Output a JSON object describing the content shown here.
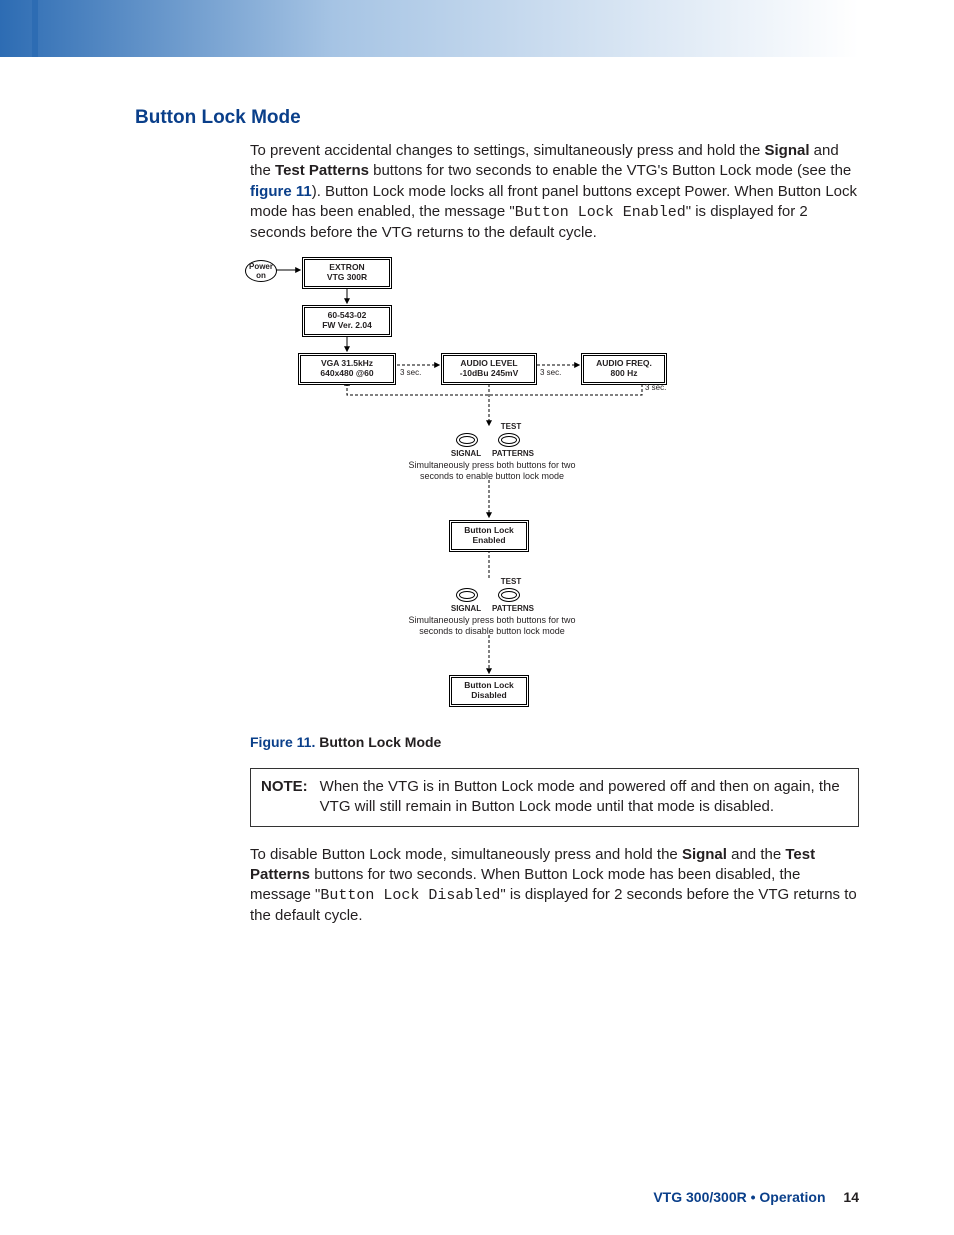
{
  "heading": "Button Lock Mode",
  "intro": {
    "pre": "To prevent accidental changes to settings, simultaneously press and hold the ",
    "b1": "Signal",
    "mid1": " and the ",
    "b2": "Test Patterns",
    "mid2": " buttons for two seconds to enable the VTG's Button Lock mode (see the ",
    "link": "figure 11",
    "mid3": "). Button Lock mode locks all front panel buttons except Power. When Button Lock mode has been enabled, the message \"",
    "mono": "Button Lock Enabled",
    "post": "\" is displayed for 2 seconds before the VTG returns to the default cycle."
  },
  "diagram": {
    "power_on": "Power on",
    "box1_l1": "EXTRON",
    "box1_l2": "VTG   300R",
    "box2_l1": "60-543-02",
    "box2_l2": "FW Ver. 2.04",
    "box3_l1": "VGA  31.5kHz",
    "box3_l2": "640x480 @60",
    "box4_l1": "AUDIO LEVEL",
    "box4_l2": "-10dBu  245mV",
    "box5_l1": "AUDIO FREQ.",
    "box5_l2": "800 Hz",
    "threesec": "3 sec.",
    "signal": "SIGNAL",
    "test": "TEST",
    "patterns": "PATTERNS",
    "cap_enable": "Simultaneously press both buttons for two seconds to enable button lock mode",
    "box_enabled_l1": "Button Lock",
    "box_enabled_l2": "Enabled",
    "cap_disable": "Simultaneously press both buttons for two seconds to disable button lock mode",
    "box_disabled_l1": "Button Lock",
    "box_disabled_l2": "Disabled"
  },
  "figure": {
    "num": "Figure 11.",
    "text": "Button Lock Mode"
  },
  "note": {
    "label": "NOTE:",
    "text": "When the VTG is in Button Lock mode and powered off and then on again, the VTG will still remain in Button Lock mode until that mode is disabled."
  },
  "outro": {
    "pre": "To disable Button Lock mode, simultaneously press and hold the ",
    "b1": "Signal",
    "mid1": " and the ",
    "b2": "Test Patterns",
    "mid2": " buttons for two seconds. When Button Lock mode has been disabled, the message \"",
    "mono": "Button Lock Disabled",
    "post": "\" is displayed for 2 seconds before the VTG returns to the default cycle."
  },
  "footer": {
    "product": "VTG 300/300R • Operation",
    "page": "14"
  }
}
